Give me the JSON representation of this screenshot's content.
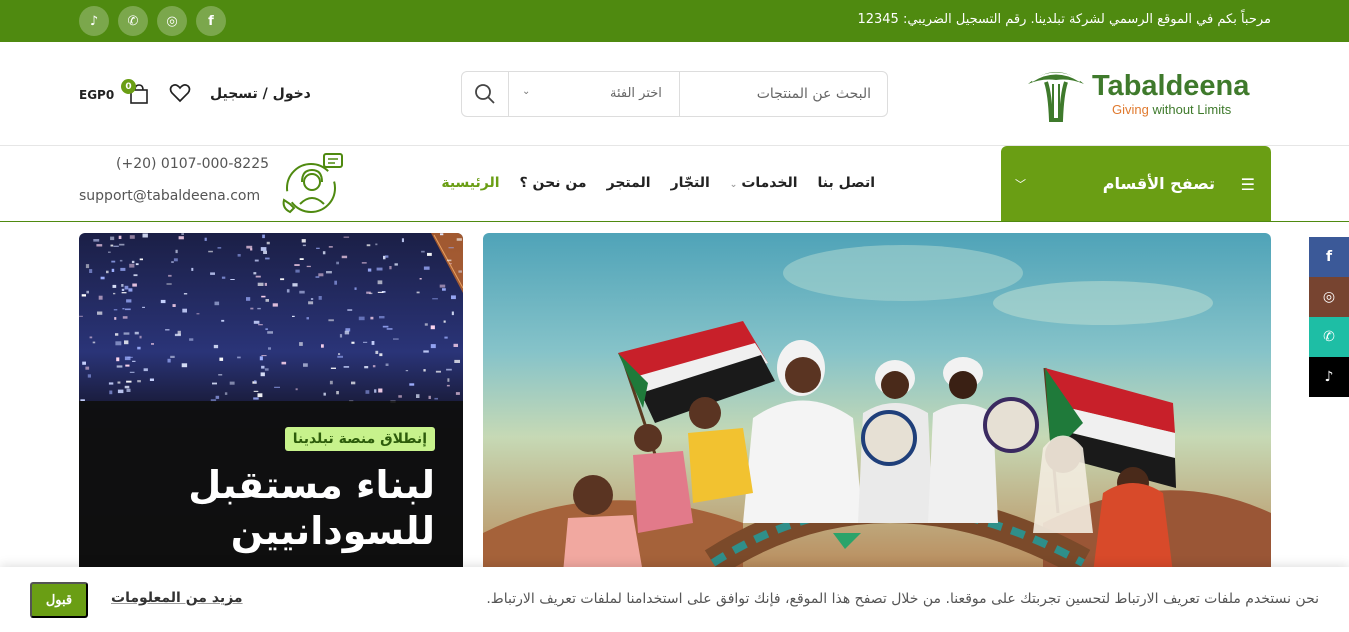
{
  "topbar": {
    "welcome": "مرحباً بكم في الموقع الرسمي لشركة تبلدينا. رقم التسجيل الضريبي: 12345",
    "social": [
      {
        "icon": "tiktok-icon",
        "glyph": "♪"
      },
      {
        "icon": "whatsapp-icon",
        "glyph": "✆"
      },
      {
        "icon": "instagram-icon",
        "glyph": "◎"
      },
      {
        "icon": "facebook-icon",
        "glyph": "f"
      }
    ]
  },
  "header": {
    "logo_name": "Tabaldeena",
    "logo_tag_a": "Giving ",
    "logo_tag_b": "without Limits",
    "search_placeholder": "البحث عن المنتجات",
    "category_placeholder": "اختر الفئة",
    "login_label": "دخول / تسجيل",
    "cart_count": "0",
    "cart_total": "EGP0"
  },
  "nav": {
    "browse_label": "تصفح الأقسام",
    "items": [
      {
        "label": "الرئيسية",
        "active": true,
        "dropdown": false
      },
      {
        "label": "من نحن ؟",
        "active": false,
        "dropdown": false
      },
      {
        "label": "المتجر",
        "active": false,
        "dropdown": false
      },
      {
        "label": "التجّار",
        "active": false,
        "dropdown": false
      },
      {
        "label": "الخدمات",
        "active": false,
        "dropdown": true
      },
      {
        "label": "اتصل بنا",
        "active": false,
        "dropdown": false
      }
    ],
    "phone": "(+20) 0107-000-8225",
    "email": "support@tabaldeena.com"
  },
  "promo": {
    "badge": "إنطلاق منصة تبلدينا",
    "title_line1": "لبناء مستقبل",
    "title_line2": "للسودانيين"
  },
  "float_social": [
    {
      "icon": "facebook-icon",
      "glyph": "f",
      "color": "#3b5998"
    },
    {
      "icon": "instagram-icon",
      "glyph": "◎",
      "color": "#774430"
    },
    {
      "icon": "whatsapp-icon",
      "glyph": "✆",
      "color": "#1ebea5"
    },
    {
      "icon": "tiktok-icon",
      "glyph": "♪",
      "color": "#000000"
    }
  ],
  "cookie": {
    "message": "نحن نستخدم ملفات تعريف الارتباط لتحسين تجربتك على موقعنا. من خلال تصفح هذا الموقع، فإنك توافق على استخدامنا لملفات تعريف الارتباط.",
    "more_label": "مزيد من المعلومات",
    "accept_label": "قبول"
  },
  "colors": {
    "brand_green": "#4f8a10",
    "accent_green": "#6a9e14"
  }
}
